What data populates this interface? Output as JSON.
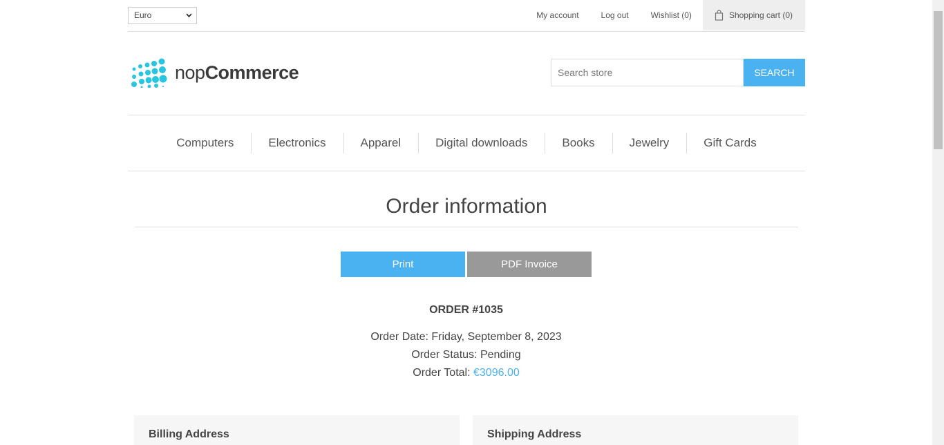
{
  "header": {
    "currency": "Euro",
    "links": {
      "my_account": "My account",
      "log_out": "Log out",
      "wishlist": "Wishlist (0)",
      "shopping_cart": "Shopping cart (0)"
    }
  },
  "logo": {
    "text_light": "nop",
    "text_bold": "Commerce"
  },
  "search": {
    "placeholder": "Search store",
    "button": "Search"
  },
  "menu": [
    "Computers",
    "Electronics",
    "Apparel",
    "Digital downloads",
    "Books",
    "Jewelry",
    "Gift Cards"
  ],
  "page": {
    "title": "Order information",
    "print": "Print",
    "pdf_invoice": "PDF Invoice",
    "order_number": "ORDER #1035",
    "order_date_label": "Order Date:",
    "order_date": "Friday, September 8, 2023",
    "order_status_label": "Order Status:",
    "order_status": "Pending",
    "order_total_label": "Order Total:",
    "order_total": "€3096.00",
    "billing_title": "Billing Address",
    "shipping_title": "Shipping Address"
  },
  "colors": {
    "accent": "#4ab2f1",
    "pdf_button": "#999999",
    "logo_dots": "#29c5e0"
  },
  "icons": {
    "cart": "shopping-bag-icon",
    "currency_select": "chevron-down-icon"
  }
}
